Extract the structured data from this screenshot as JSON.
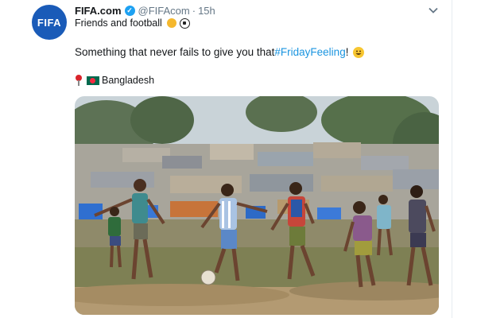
{
  "tweet": {
    "avatar_text": "FIFA",
    "author_name": "FIFA.com",
    "handle": "@FIFAcom",
    "separator": "·",
    "time": "15h",
    "bio": "Friends and football",
    "text_prefix": "Something that never fails to give you that ",
    "hashtag": "#FridayFeeling",
    "text_suffix": "!",
    "location": "Bangladesh",
    "photo_icon": "photo-children-playing-football",
    "menu_icon": "chevron-down-icon"
  },
  "colors": {
    "brand": "#1a5bb8",
    "link": "#1b95e0",
    "muted": "#657786"
  }
}
